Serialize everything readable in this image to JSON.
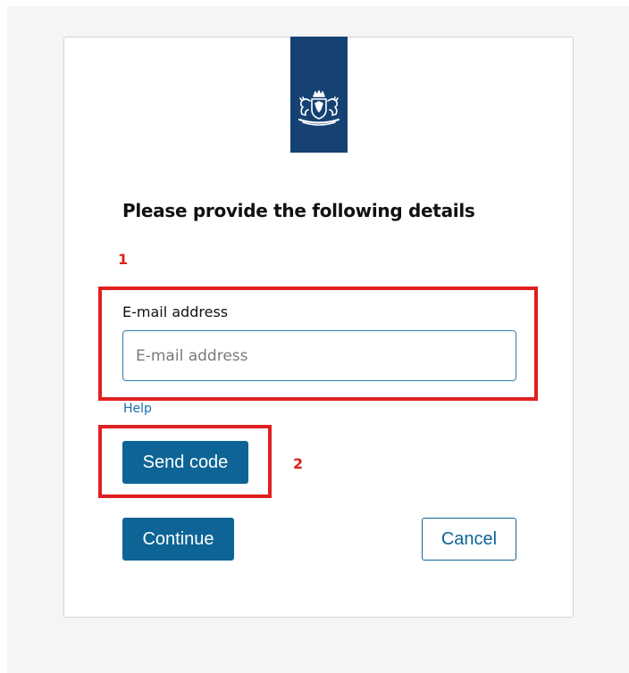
{
  "form": {
    "heading": "Please provide the following details",
    "email_label": "E-mail address",
    "email_placeholder": "E-mail address",
    "email_value": "",
    "help_link": "Help",
    "send_code_label": "Send code",
    "continue_label": "Continue",
    "cancel_label": "Cancel"
  },
  "annotations": {
    "marker_1": "1",
    "marker_2": "2",
    "color": "#e02020"
  },
  "logo": {
    "icon": "coat-of-arms-icon",
    "color": "#154273"
  },
  "colors": {
    "primary_button": "#0e6496",
    "link": "#1a6fa8",
    "input_border": "#2c7fb4",
    "page_background": "#f5f5f5"
  }
}
